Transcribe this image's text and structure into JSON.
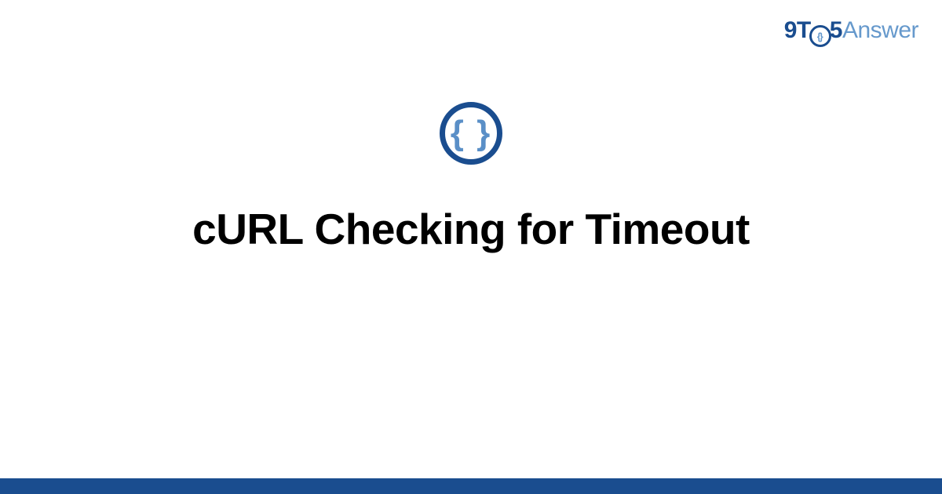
{
  "brand": {
    "part1": "9T",
    "part2": "5",
    "part3": "Answer",
    "clock_glyph": "{}"
  },
  "center_icon": {
    "glyph": "{ }"
  },
  "title": "cURL Checking for Timeout",
  "colors": {
    "brand_dark": "#1a4d8f",
    "brand_light": "#6699cc"
  }
}
